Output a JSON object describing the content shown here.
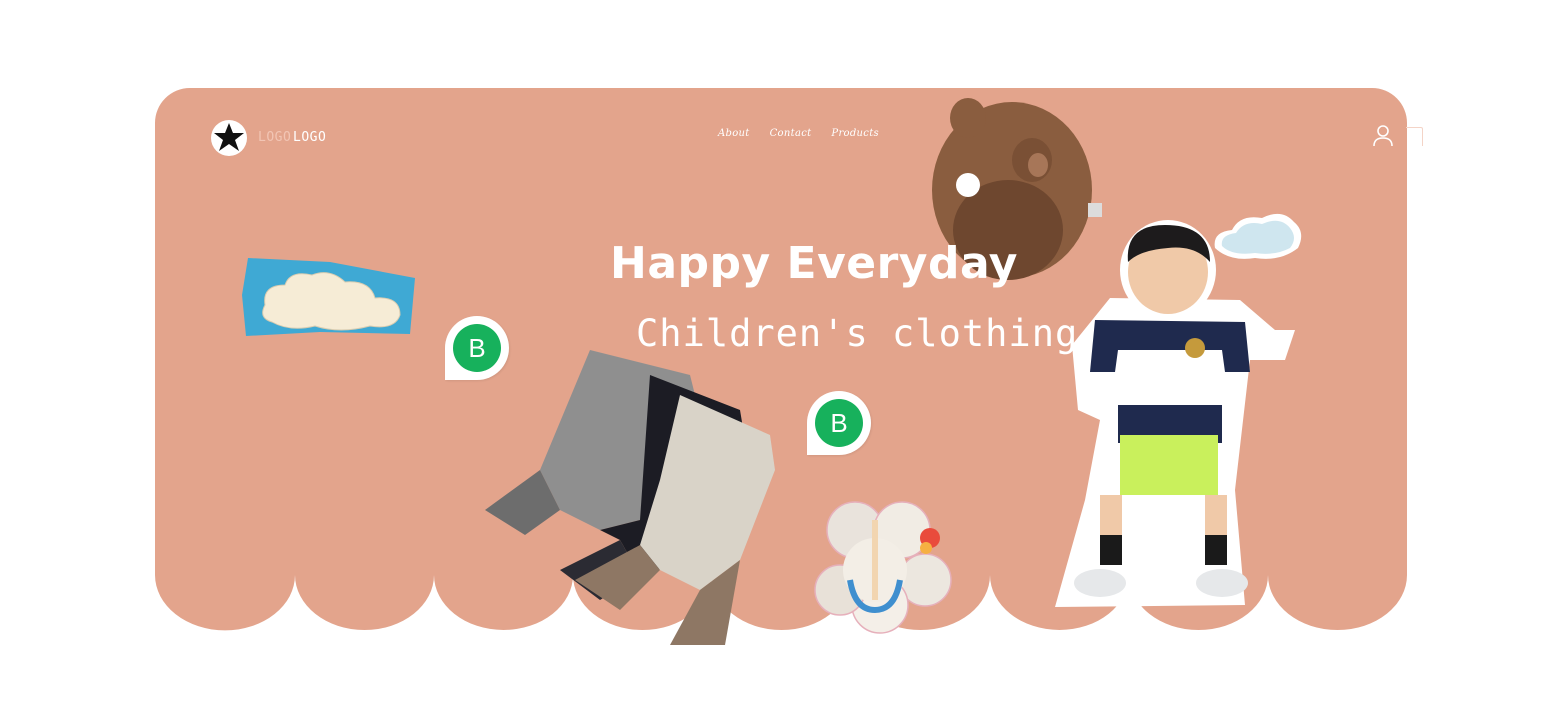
{
  "brand": {
    "logo_text_faded": "LOGO",
    "logo_text": "LOGO"
  },
  "nav": {
    "items": [
      {
        "label": "About"
      },
      {
        "label": "Contact"
      },
      {
        "label": "Products"
      }
    ]
  },
  "hero": {
    "title": "Happy Everyday",
    "subtitle": "Children's clothing"
  },
  "badges": {
    "badge_1_label": "B",
    "badge_2_label": "B"
  },
  "colors": {
    "hero_background": "#e3a48c",
    "badge_green": "#17b15c",
    "cloud_blue": "#3fa9d4",
    "white": "#ffffff"
  },
  "icons": {
    "account": "user-icon",
    "cart": "cart-icon"
  }
}
